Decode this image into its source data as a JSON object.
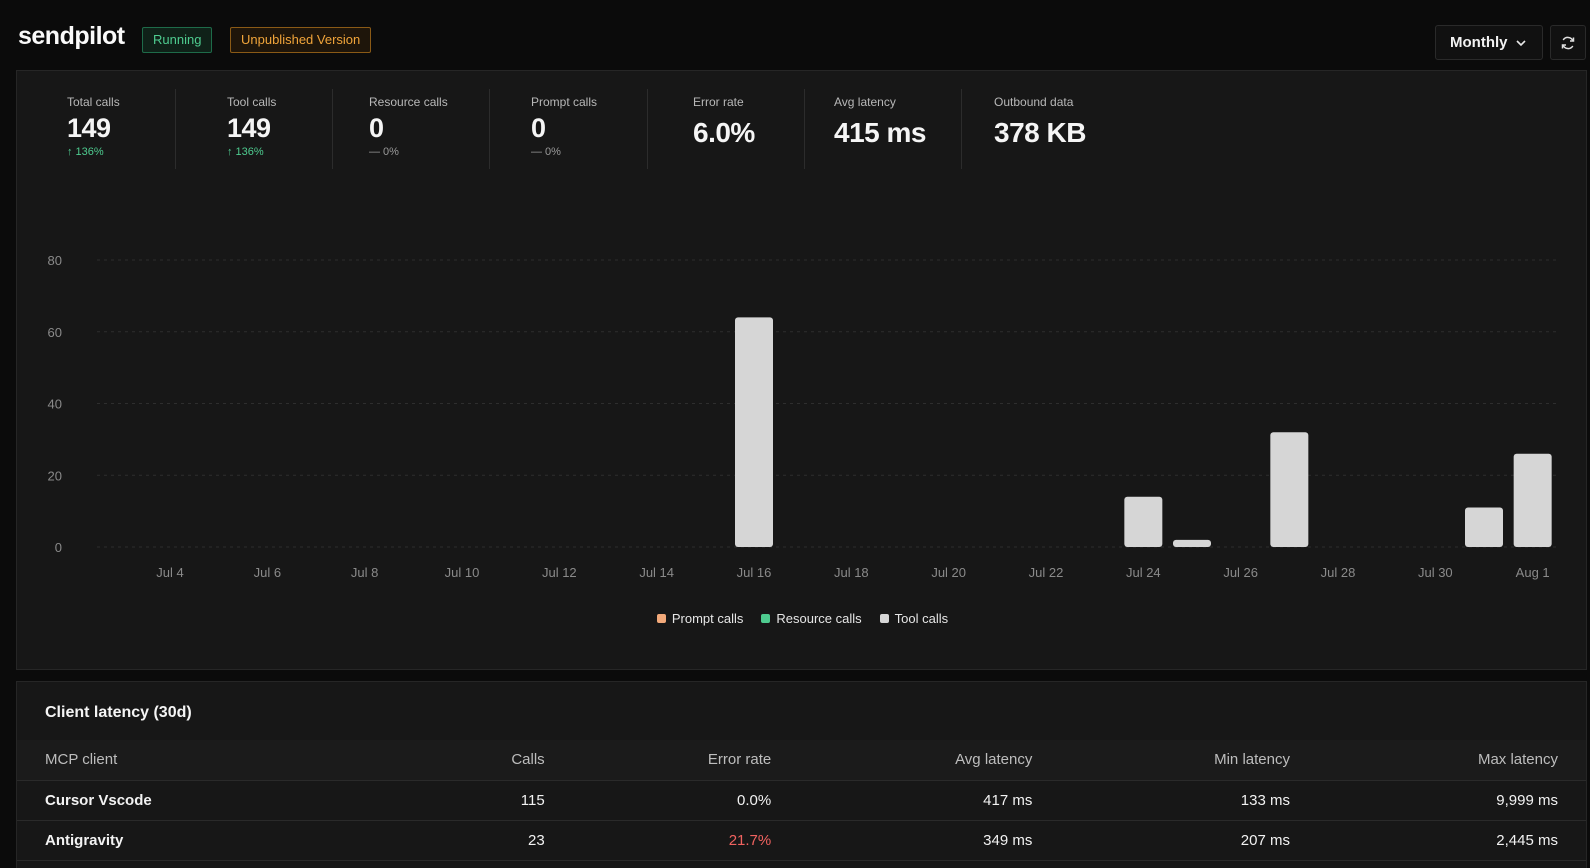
{
  "header": {
    "brand": "sendpilot",
    "status_badge": "Running",
    "version_badge": "Unpublished Version",
    "period": "Monthly"
  },
  "stats": [
    {
      "label": "Total calls",
      "value": "149",
      "change": "136%",
      "trend": "up"
    },
    {
      "label": "Tool calls",
      "value": "149",
      "change": "136%",
      "trend": "up"
    },
    {
      "label": "Resource calls",
      "value": "0",
      "change": "0%",
      "trend": "flat"
    },
    {
      "label": "Prompt calls",
      "value": "0",
      "change": "0%",
      "trend": "flat"
    },
    {
      "label": "Error rate",
      "value": "6.0%"
    },
    {
      "label": "Avg latency",
      "value": "415 ms"
    },
    {
      "label": "Outbound data",
      "value": "378 KB"
    }
  ],
  "chart_data": {
    "type": "bar",
    "ylim": [
      0,
      80
    ],
    "yticks": [
      0,
      20,
      40,
      60,
      80
    ],
    "x_tick_labels": [
      "Jul 4",
      "Jul 6",
      "Jul 8",
      "Jul 10",
      "Jul 12",
      "Jul 14",
      "Jul 16",
      "Jul 18",
      "Jul 20",
      "Jul 22",
      "Jul 24",
      "Jul 26",
      "Jul 28",
      "Jul 30",
      "Aug 1"
    ],
    "categories": [
      "Jul 3",
      "Jul 4",
      "Jul 5",
      "Jul 6",
      "Jul 7",
      "Jul 8",
      "Jul 9",
      "Jul 10",
      "Jul 11",
      "Jul 12",
      "Jul 13",
      "Jul 14",
      "Jul 15",
      "Jul 16",
      "Jul 17",
      "Jul 18",
      "Jul 19",
      "Jul 20",
      "Jul 21",
      "Jul 22",
      "Jul 23",
      "Jul 24",
      "Jul 25",
      "Jul 26",
      "Jul 27",
      "Jul 28",
      "Jul 29",
      "Jul 30",
      "Jul 31",
      "Aug 1"
    ],
    "series": [
      {
        "name": "Prompt calls",
        "color": "#f2a97a",
        "values": [
          0,
          0,
          0,
          0,
          0,
          0,
          0,
          0,
          0,
          0,
          0,
          0,
          0,
          0,
          0,
          0,
          0,
          0,
          0,
          0,
          0,
          0,
          0,
          0,
          0,
          0,
          0,
          0,
          0,
          0
        ]
      },
      {
        "name": "Resource calls",
        "color": "#4ecb8f",
        "values": [
          0,
          0,
          0,
          0,
          0,
          0,
          0,
          0,
          0,
          0,
          0,
          0,
          0,
          0,
          0,
          0,
          0,
          0,
          0,
          0,
          0,
          0,
          0,
          0,
          0,
          0,
          0,
          0,
          0,
          0
        ]
      },
      {
        "name": "Tool calls",
        "color": "#d6d6d6",
        "values": [
          0,
          0,
          0,
          0,
          0,
          0,
          0,
          0,
          0,
          0,
          0,
          0,
          0,
          64,
          0,
          0,
          0,
          0,
          0,
          0,
          0,
          14,
          2,
          0,
          32,
          0,
          0,
          0,
          11,
          26
        ]
      }
    ],
    "grid": true,
    "legend": "bottom-center"
  },
  "latency": {
    "title": "Client latency (30d)",
    "columns": [
      "MCP client",
      "Calls",
      "Error rate",
      "Avg latency",
      "Min latency",
      "Max latency"
    ],
    "rows": [
      [
        "Cursor Vscode",
        "115",
        "0.0%",
        "417 ms",
        "133 ms",
        "9,999 ms"
      ],
      [
        "Antigravity",
        "23",
        "21.7%",
        "349 ms",
        "207 ms",
        "2,445 ms"
      ]
    ]
  },
  "colors": {
    "error": "#f0625f",
    "ok": "#4ecb8f"
  }
}
